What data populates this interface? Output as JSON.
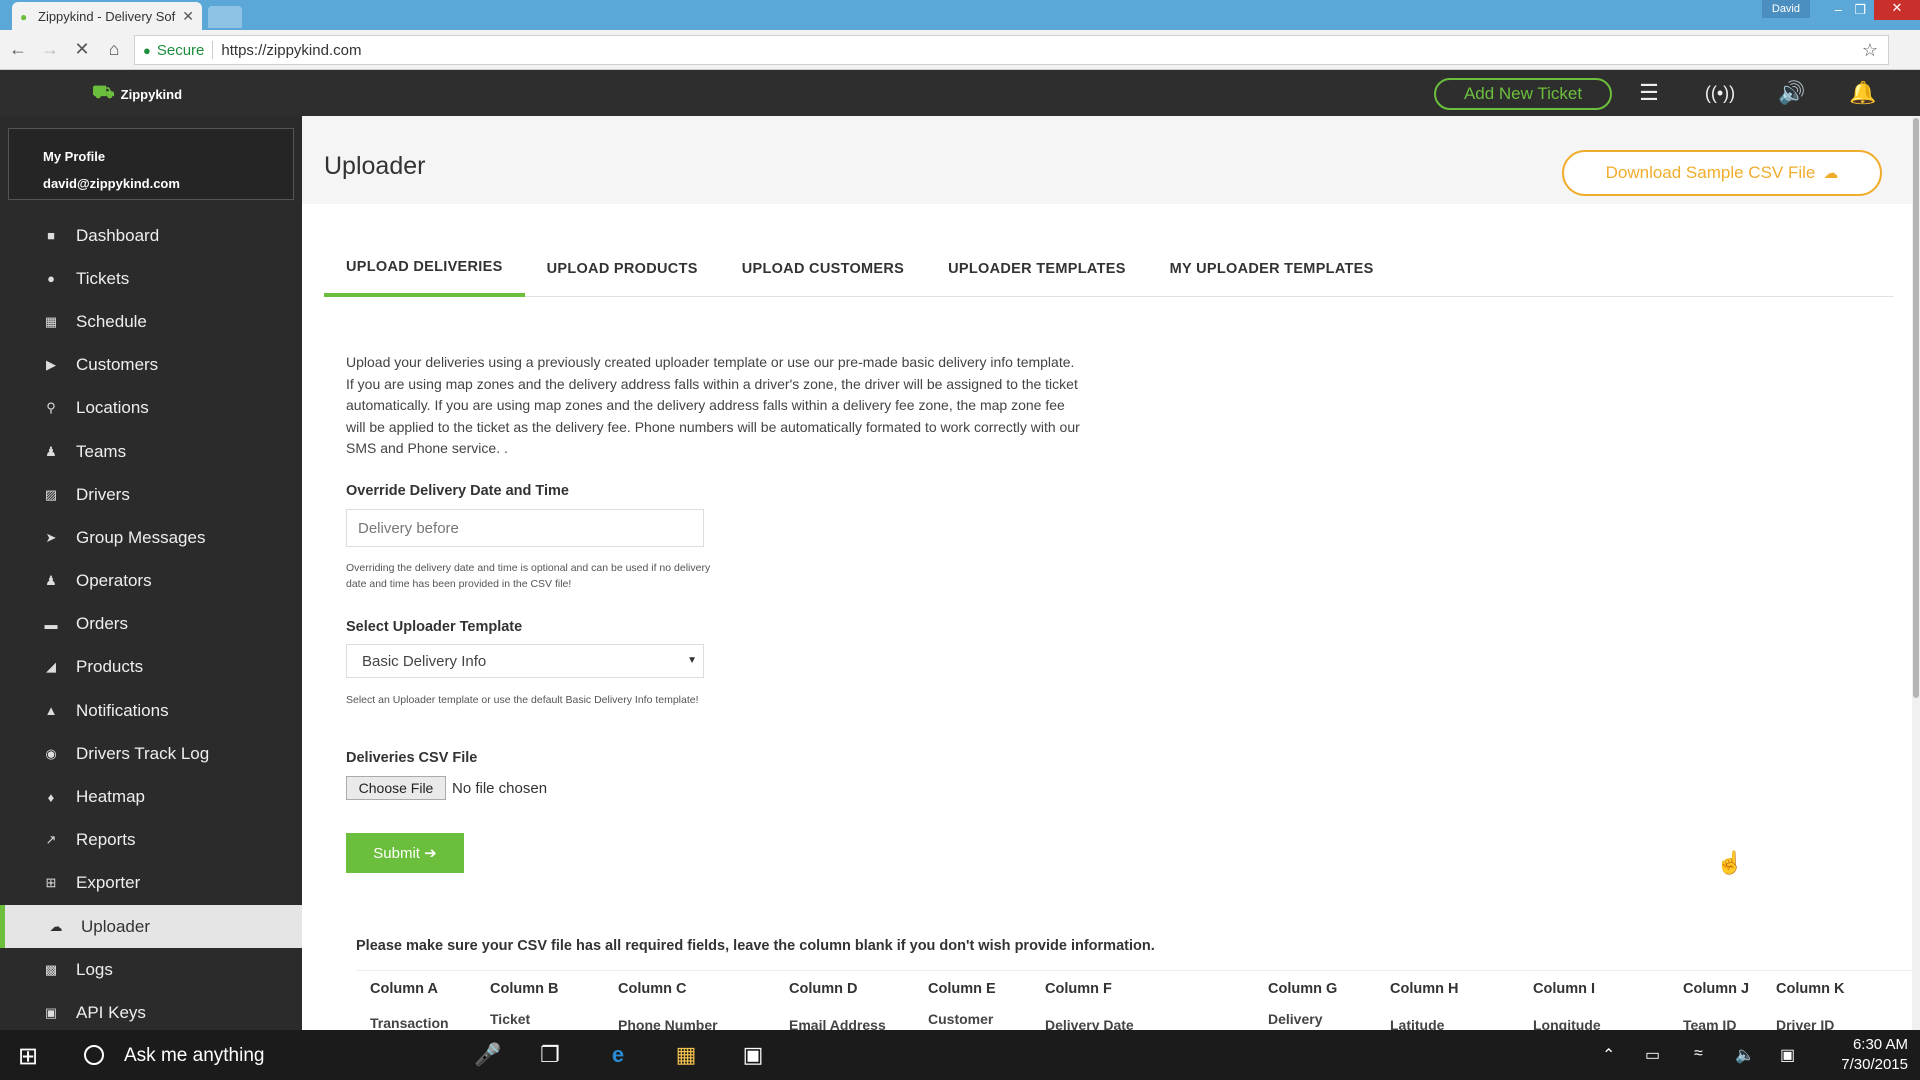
{
  "browser": {
    "tab_title": "Zippykind - Delivery Sof",
    "secure_label": "Secure",
    "url": "https://zippykind.com",
    "window_user": "David"
  },
  "header": {
    "logo_text": "Zippykind",
    "add_ticket_label": "Add New Ticket"
  },
  "profile": {
    "title": "My Profile",
    "email": "david@zippykind.com"
  },
  "sidebar": {
    "items": [
      {
        "label": "Dashboard",
        "icon": "dashboard-icon"
      },
      {
        "label": "Tickets",
        "icon": "tickets-icon"
      },
      {
        "label": "Schedule",
        "icon": "calendar-icon"
      },
      {
        "label": "Customers",
        "icon": "cart-icon"
      },
      {
        "label": "Locations",
        "icon": "location-pin-icon"
      },
      {
        "label": "Teams",
        "icon": "team-icon"
      },
      {
        "label": "Drivers",
        "icon": "car-icon"
      },
      {
        "label": "Group Messages",
        "icon": "paper-plane-icon"
      },
      {
        "label": "Operators",
        "icon": "users-icon"
      },
      {
        "label": "Orders",
        "icon": "credit-card-icon"
      },
      {
        "label": "Products",
        "icon": "tag-icon"
      },
      {
        "label": "Notifications",
        "icon": "bell-icon"
      },
      {
        "label": "Drivers Track Log",
        "icon": "crosshair-icon"
      },
      {
        "label": "Heatmap",
        "icon": "fire-icon"
      },
      {
        "label": "Reports",
        "icon": "chart-line-icon"
      },
      {
        "label": "Exporter",
        "icon": "export-icon"
      },
      {
        "label": "Uploader",
        "icon": "cloud-upload-icon"
      },
      {
        "label": "Logs",
        "icon": "log-icon"
      },
      {
        "label": "API Keys",
        "icon": "lock-icon"
      }
    ],
    "active_item": "Uploader"
  },
  "page": {
    "title": "Uploader",
    "download_label": "Download Sample CSV File",
    "tabs": [
      "UPLOAD DELIVERIES",
      "UPLOAD PRODUCTS",
      "UPLOAD CUSTOMERS",
      "UPLOADER TEMPLATES",
      "MY UPLOADER TEMPLATES"
    ],
    "active_tab": "UPLOAD DELIVERIES",
    "description": "Upload your deliveries using a previously created uploader template or use our pre-made basic delivery info template. If you are using map zones and the delivery address falls within a driver's zone, the driver will be assigned to the ticket automatically. If you are using map zones and the delivery address falls within a delivery fee zone, the map zone fee will be applied to the ticket as the delivery fee. Phone numbers will be automatically formated to work correctly with our SMS and Phone service. .",
    "override": {
      "label": "Override Delivery Date and Time",
      "placeholder": "Delivery before",
      "value": "",
      "help": "Overriding the delivery date and time is optional and can be used if no delivery date and time has been provided in the CSV file!"
    },
    "template": {
      "label": "Select Uploader Template",
      "selected": "Basic Delivery Info",
      "help": "Select an Uploader template or use the default Basic Delivery Info template!"
    },
    "file": {
      "label": "Deliveries CSV File",
      "button_label": "Choose File",
      "status": "No file chosen"
    },
    "submit_label": "Submit ➔",
    "notice": "Please make sure your CSV file has all required fields, leave the column blank if you don't wish provide information.",
    "columns": [
      {
        "head": "Column A",
        "cell": "Transaction"
      },
      {
        "head": "Column B",
        "cell": "Ticket"
      },
      {
        "head": "Column C",
        "cell": "Phone Number"
      },
      {
        "head": "Column D",
        "cell": "Email Address"
      },
      {
        "head": "Column E",
        "cell": "Customer"
      },
      {
        "head": "Column F",
        "cell": "Delivery Date"
      },
      {
        "head": "Column G",
        "cell": "Delivery"
      },
      {
        "head": "Column H",
        "cell": "Latitude"
      },
      {
        "head": "Column I",
        "cell": "Longitude"
      },
      {
        "head": "Column J",
        "cell": "Team ID"
      },
      {
        "head": "Column K",
        "cell": "Driver ID"
      }
    ]
  },
  "taskbar": {
    "search_text": "Ask me anything",
    "time": "6:30 AM",
    "date": "7/30/2015"
  },
  "colors": {
    "accent_green": "#6cbf3c",
    "download_orange": "#f0ad2c",
    "sidebar_bg": "#2b2b2b"
  }
}
